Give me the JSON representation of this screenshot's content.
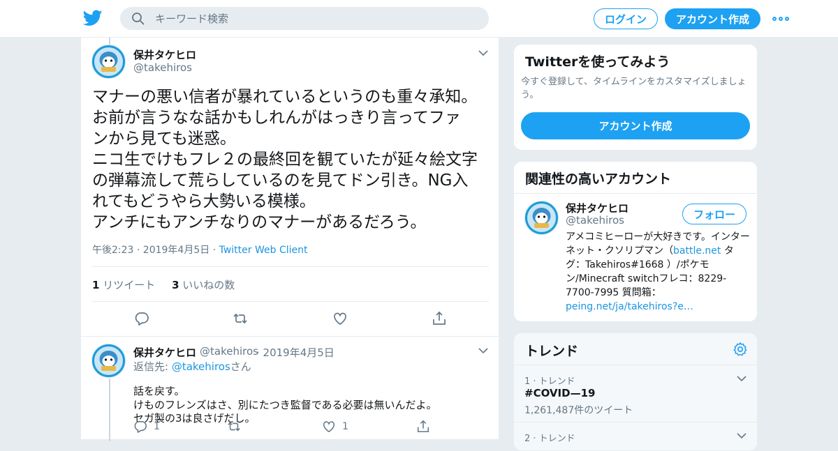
{
  "header": {
    "search_placeholder": "キーワード検索",
    "login_label": "ログイン",
    "signup_label": "アカウント作成"
  },
  "tweet": {
    "author_name": "保井タケヒロ",
    "author_handle": "@takehiros",
    "lines": [
      "マナーの悪い信者が暴れているというのも重々承知。",
      "お前が言うなな話かもしれんがはっきり言ってファ",
      "ンから見ても迷惑。",
      "ニコ生でけもフレ２の最終回を観ていたが延々絵文字",
      "の弾幕流して荒らしているのを見てドン引き。NG入",
      "れてもどうやら大勢いる模様。",
      "アンチにもアンチなりのマナーがあるだろう。"
    ],
    "timestamp": "午後2:23 · 2019年4月5日",
    "separator": "·",
    "client": "Twitter Web Client",
    "retweet_count": "1",
    "retweet_label": "リツイート",
    "like_count": "3",
    "like_label": "いいねの数"
  },
  "reply": {
    "author_name": "保井タケヒロ",
    "author_handle": "@takehiros",
    "date": "· 2019年4月5日",
    "reply_to_prefix": "返信先: ",
    "reply_to_handle": "@takehiros",
    "reply_to_suffix": "さん",
    "lines": [
      "話を戻す。",
      "けものフレンズはさ、別にたつき監督である必要は無いんだよ。",
      "セガ製の3は良さげだし。"
    ],
    "reply_count": "1",
    "like_count": "1"
  },
  "signup_card": {
    "title": "Twitterを使ってみよう",
    "description": "今すぐ登録して、タイムラインをカスタマイズしましょう。",
    "button_label": "アカウント作成"
  },
  "related_card": {
    "title": "関連性の高いアカウント",
    "name": "保井タケヒロ",
    "handle": "@takehiros",
    "follow_label": "フォロー",
    "bio_1": "アメコミヒーローが大好きです。インターネット・クソリプマン（",
    "bio_link_1": "battle.net",
    "bio_2": " タグ：Takehiros#1668 ）/ポケモン/Minecraft switchフレコ：8229-7700-7995 質問箱：",
    "bio_link_2": "peing.net/ja/takehiros?e…"
  },
  "trends": {
    "title": "トレンド",
    "items": [
      {
        "meta": "1 · トレンド",
        "name": "#COVID—19",
        "count": "1,261,487件のツイート"
      },
      {
        "meta": "2 · トレンド",
        "name": "",
        "count": ""
      }
    ]
  },
  "colors": {
    "accent": "#1da1f2",
    "link": "#1b95e0",
    "muted": "#657786",
    "background": "#e6ecf0"
  }
}
